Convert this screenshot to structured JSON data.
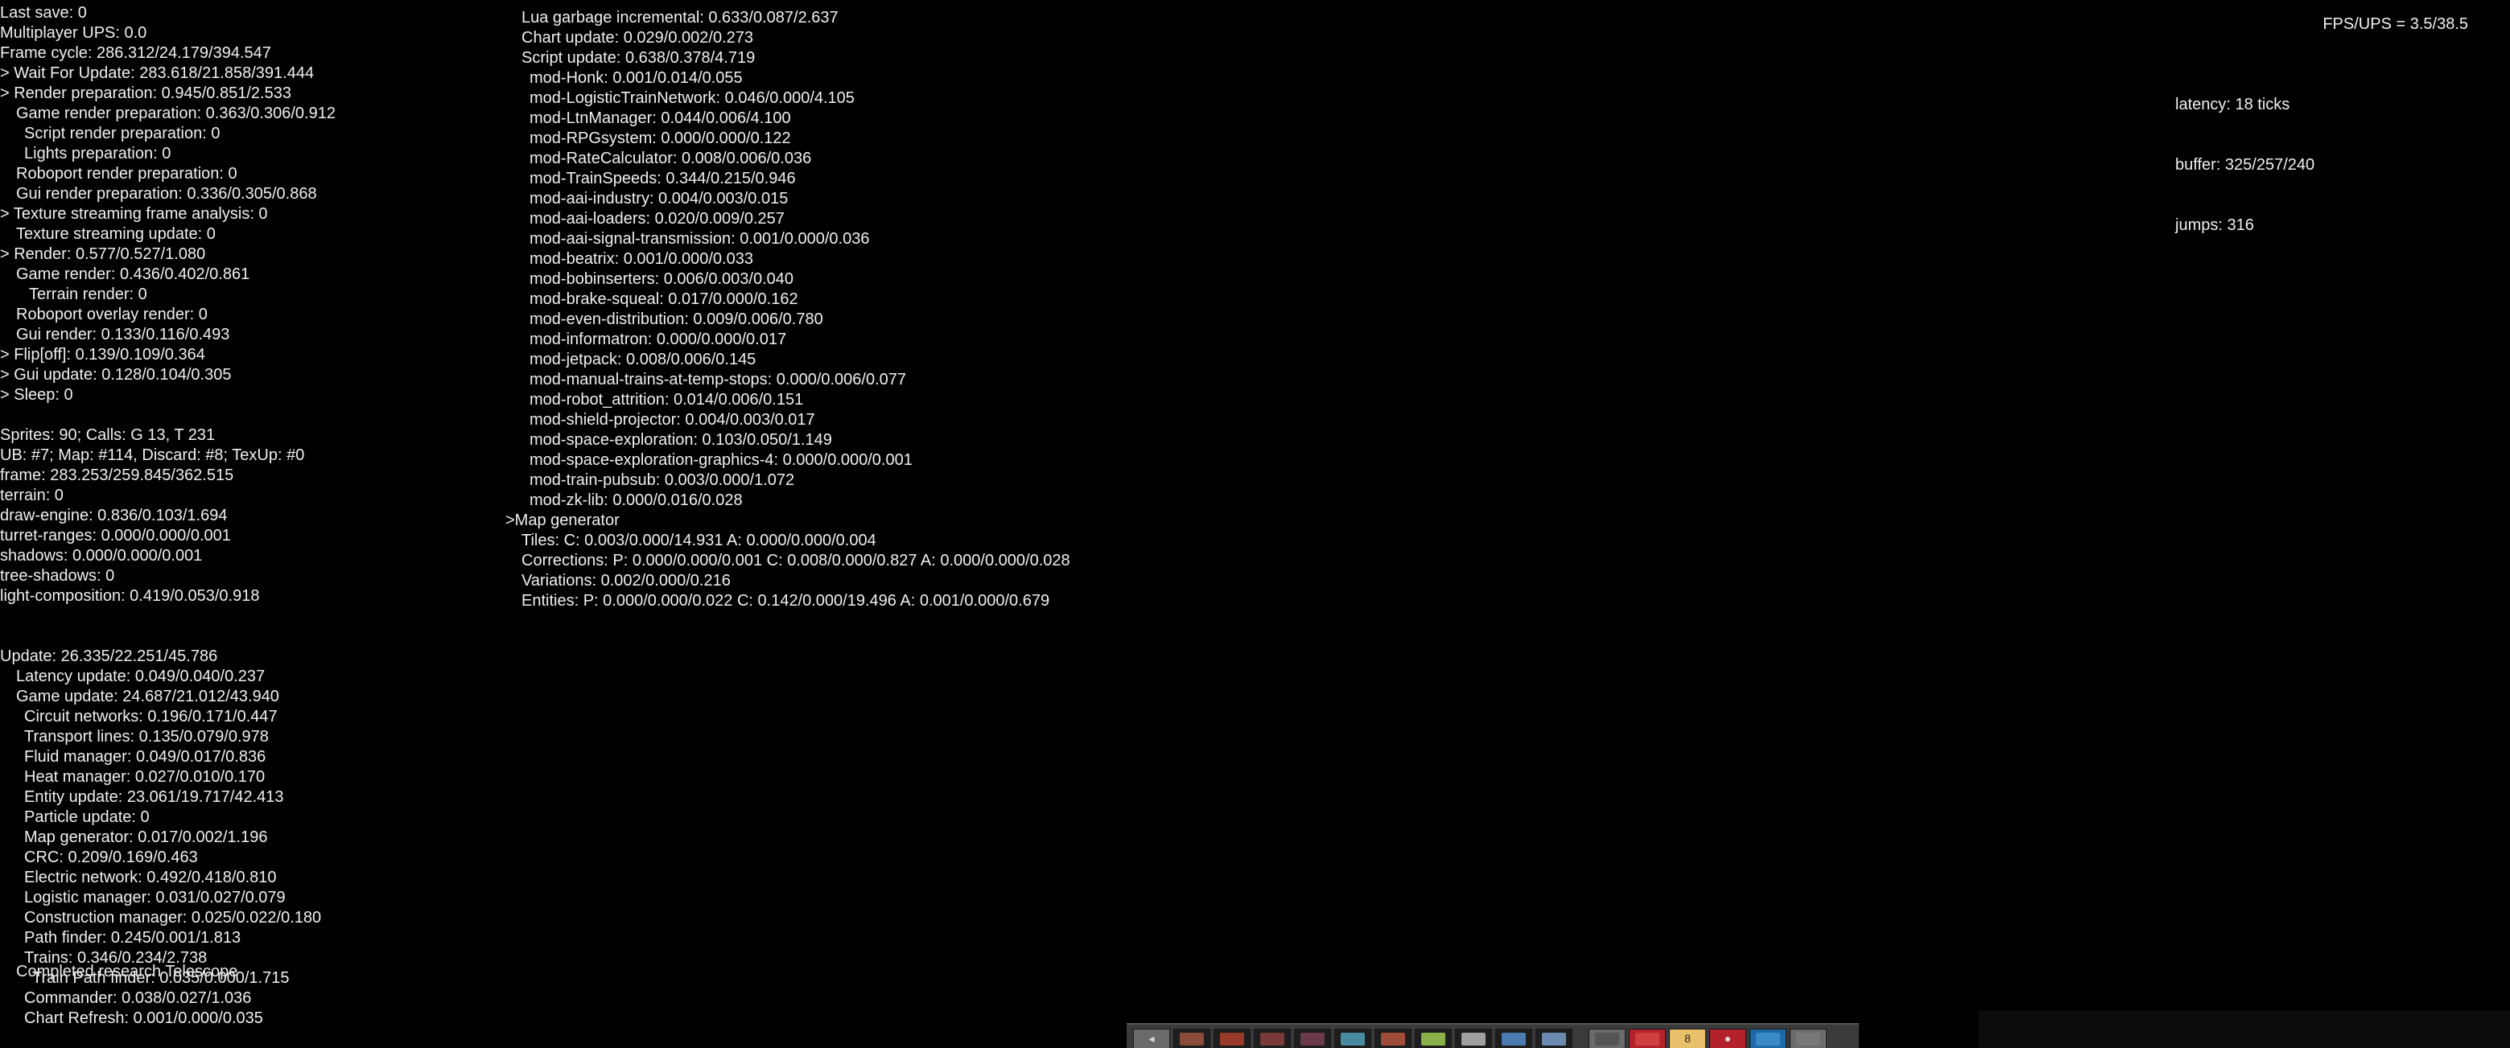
{
  "left_lines": [
    {
      "t": "Last save: 0",
      "i": 0
    },
    {
      "t": "Multiplayer UPS: 0.0",
      "i": 0
    },
    {
      "t": "Frame cycle: 286.312/24.179/394.547",
      "i": 0
    },
    {
      "t": "> Wait For Update: 283.618/21.858/391.444",
      "i": 0
    },
    {
      "t": "> Render preparation: 0.945/0.851/2.533",
      "i": 0
    },
    {
      "t": "Game render preparation: 0.363/0.306/0.912",
      "i": 1
    },
    {
      "t": "Script render preparation: 0",
      "i": 2
    },
    {
      "t": "Lights preparation: 0",
      "i": 2
    },
    {
      "t": "Roboport render preparation: 0",
      "i": 1
    },
    {
      "t": "Gui render preparation: 0.336/0.305/0.868",
      "i": 1
    },
    {
      "t": "> Texture streaming frame analysis: 0",
      "i": 0
    },
    {
      "t": "Texture streaming update: 0",
      "i": 1
    },
    {
      "t": "> Render: 0.577/0.527/1.080",
      "i": 0
    },
    {
      "t": "Game render: 0.436/0.402/0.861",
      "i": 1
    },
    {
      "t": "Terrain render: 0",
      "i": 3
    },
    {
      "t": "Roboport overlay render: 0",
      "i": 1
    },
    {
      "t": "Gui render: 0.133/0.116/0.493",
      "i": 1
    },
    {
      "t": "> Flip[off]: 0.139/0.109/0.364",
      "i": 0
    },
    {
      "t": "> Gui update: 0.128/0.104/0.305",
      "i": 0
    },
    {
      "t": "> Sleep: 0",
      "i": 0
    },
    {
      "t": "",
      "i": 0
    },
    {
      "t": "Sprites: 90; Calls: G 13, T 231",
      "i": 0
    },
    {
      "t": "UB: #7; Map: #114, Discard: #8; TexUp: #0",
      "i": 0
    },
    {
      "t": "frame: 283.253/259.845/362.515",
      "i": 0
    },
    {
      "t": "terrain: 0",
      "i": 0
    },
    {
      "t": "draw-engine: 0.836/0.103/1.694",
      "i": 0
    },
    {
      "t": "turret-ranges: 0.000/0.000/0.001",
      "i": 0
    },
    {
      "t": "shadows: 0.000/0.000/0.001",
      "i": 0
    },
    {
      "t": "tree-shadows: 0",
      "i": 0
    },
    {
      "t": "light-composition: 0.419/0.053/0.918",
      "i": 0
    },
    {
      "t": "",
      "i": 0
    },
    {
      "t": "",
      "i": 0
    },
    {
      "t": "Update: 26.335/22.251/45.786",
      "i": 0
    },
    {
      "t": "Latency update: 0.049/0.040/0.237",
      "i": 1
    },
    {
      "t": "Game update: 24.687/21.012/43.940",
      "i": 1
    },
    {
      "t": "Circuit networks: 0.196/0.171/0.447",
      "i": 2
    },
    {
      "t": "Transport lines: 0.135/0.079/0.978",
      "i": 2
    },
    {
      "t": "Fluid manager: 0.049/0.017/0.836",
      "i": 2
    },
    {
      "t": "Heat manager: 0.027/0.010/0.170",
      "i": 2
    },
    {
      "t": "Entity update: 23.061/19.717/42.413",
      "i": 2
    },
    {
      "t": "Particle update: 0",
      "i": 2
    },
    {
      "t": "Map generator: 0.017/0.002/1.196",
      "i": 2
    },
    {
      "t": "CRC: 0.209/0.169/0.463",
      "i": 2
    },
    {
      "t": "Electric network: 0.492/0.418/0.810",
      "i": 2
    },
    {
      "t": "Logistic manager: 0.031/0.027/0.079",
      "i": 2
    },
    {
      "t": "Construction manager: 0.025/0.022/0.180",
      "i": 2
    },
    {
      "t": "Path finder: 0.245/0.001/1.813",
      "i": 2
    },
    {
      "t": "Trains: 0.346/0.234/2.738",
      "i": 2
    },
    {
      "t": "Train Path finder: 0.035/0.000/1.715",
      "i": 4
    },
    {
      "t": "Commander: 0.038/0.027/1.036",
      "i": 2
    },
    {
      "t": "Chart Refresh: 0.001/0.000/0.035",
      "i": 2
    }
  ],
  "middle_lines": [
    {
      "t": "Lua garbage incremental: 0.633/0.087/2.637",
      "i": 1
    },
    {
      "t": "Chart update: 0.029/0.002/0.273",
      "i": 1
    },
    {
      "t": "Script update: 0.638/0.378/4.719",
      "i": 1
    },
    {
      "t": "mod-Honk: 0.001/0.014/0.055",
      "i": 2
    },
    {
      "t": "mod-LogisticTrainNetwork: 0.046/0.000/4.105",
      "i": 2
    },
    {
      "t": "mod-LtnManager: 0.044/0.006/4.100",
      "i": 2
    },
    {
      "t": "mod-RPGsystem: 0.000/0.000/0.122",
      "i": 2
    },
    {
      "t": "mod-RateCalculator: 0.008/0.006/0.036",
      "i": 2
    },
    {
      "t": "mod-TrainSpeeds: 0.344/0.215/0.946",
      "i": 2
    },
    {
      "t": "mod-aai-industry: 0.004/0.003/0.015",
      "i": 2
    },
    {
      "t": "mod-aai-loaders: 0.020/0.009/0.257",
      "i": 2
    },
    {
      "t": "mod-aai-signal-transmission: 0.001/0.000/0.036",
      "i": 2
    },
    {
      "t": "mod-beatrix: 0.001/0.000/0.033",
      "i": 2
    },
    {
      "t": "mod-bobinserters: 0.006/0.003/0.040",
      "i": 2
    },
    {
      "t": "mod-brake-squeal: 0.017/0.000/0.162",
      "i": 2
    },
    {
      "t": "mod-even-distribution: 0.009/0.006/0.780",
      "i": 2
    },
    {
      "t": "mod-informatron: 0.000/0.000/0.017",
      "i": 2
    },
    {
      "t": "mod-jetpack: 0.008/0.006/0.145",
      "i": 2
    },
    {
      "t": "mod-manual-trains-at-temp-stops: 0.000/0.006/0.077",
      "i": 2
    },
    {
      "t": "mod-robot_attrition: 0.014/0.006/0.151",
      "i": 2
    },
    {
      "t": "mod-shield-projector: 0.004/0.003/0.017",
      "i": 2
    },
    {
      "t": "mod-space-exploration: 0.103/0.050/1.149",
      "i": 2
    },
    {
      "t": "mod-space-exploration-graphics-4: 0.000/0.000/0.001",
      "i": 2
    },
    {
      "t": "mod-train-pubsub: 0.003/0.000/1.072",
      "i": 2
    },
    {
      "t": "mod-zk-lib: 0.000/0.016/0.028",
      "i": 2
    },
    {
      "t": ">Map generator",
      "i": 0
    },
    {
      "t": "Tiles: C: 0.003/0.000/14.931 A: 0.000/0.000/0.004",
      "i": 1
    },
    {
      "t": "Corrections: P: 0.000/0.000/0.001 C: 0.008/0.000/0.827 A: 0.000/0.000/0.028",
      "i": 1
    },
    {
      "t": "Variations: 0.002/0.000/0.216",
      "i": 1
    },
    {
      "t": "Entities: P: 0.000/0.000/0.022 C: 0.142/0.000/19.496 A: 0.001/0.000/0.679",
      "i": 1
    }
  ],
  "fps": "FPS/UPS = 3.5/38.5",
  "network": {
    "latency": "latency: 18 ticks",
    "buffer": "buffer: 325/257/240",
    "jumps": "jumps: 316"
  },
  "notice": "Completed research Telescope",
  "quickbar": {
    "slots": [
      {
        "name": "quickbar-slot-back",
        "style": "grey",
        "label": "◂",
        "icon_color": ""
      },
      {
        "name": "quickbar-slot-1",
        "style": "dark",
        "label": "",
        "icon_color": "#8a4a3a"
      },
      {
        "name": "quickbar-slot-2",
        "style": "dark",
        "label": "",
        "icon_color": "#9a3a2a"
      },
      {
        "name": "quickbar-slot-3",
        "style": "dark",
        "label": "",
        "icon_color": "#7a3a3a"
      },
      {
        "name": "quickbar-slot-4",
        "style": "dark",
        "label": "",
        "icon_color": "#6a3a4a"
      },
      {
        "name": "quickbar-slot-5",
        "style": "dark",
        "label": "",
        "icon_color": "#4a8aa0"
      },
      {
        "name": "quickbar-slot-6",
        "style": "dark",
        "label": "",
        "icon_color": "#a04a3a"
      },
      {
        "name": "quickbar-slot-7",
        "style": "dark",
        "label": "",
        "icon_color": "#8ab04a"
      },
      {
        "name": "quickbar-slot-8",
        "style": "dark",
        "label": "",
        "icon_color": "#a0a0a0"
      },
      {
        "name": "quickbar-slot-9",
        "style": "dark",
        "label": "",
        "icon_color": "#4a7ab0"
      },
      {
        "name": "quickbar-slot-10",
        "style": "dark",
        "label": "",
        "icon_color": "#6a8ab0"
      },
      {
        "name": "sep",
        "style": "sep",
        "label": "",
        "icon_color": ""
      },
      {
        "name": "toolbar-button-1",
        "style": "grey",
        "label": "",
        "icon_color": "#555555"
      },
      {
        "name": "toolbar-button-2",
        "style": "red",
        "label": "",
        "icon_color": "#d04040"
      },
      {
        "name": "toolbar-button-3",
        "style": "yellow",
        "label": "8",
        "icon_color": ""
      },
      {
        "name": "toolbar-button-4",
        "style": "red",
        "label": "●",
        "icon_color": ""
      },
      {
        "name": "toolbar-button-5",
        "style": "blue",
        "label": "",
        "icon_color": "#3a8ac8"
      },
      {
        "name": "toolbar-button-6",
        "style": "grey",
        "label": "",
        "icon_color": "#777777"
      }
    ]
  }
}
